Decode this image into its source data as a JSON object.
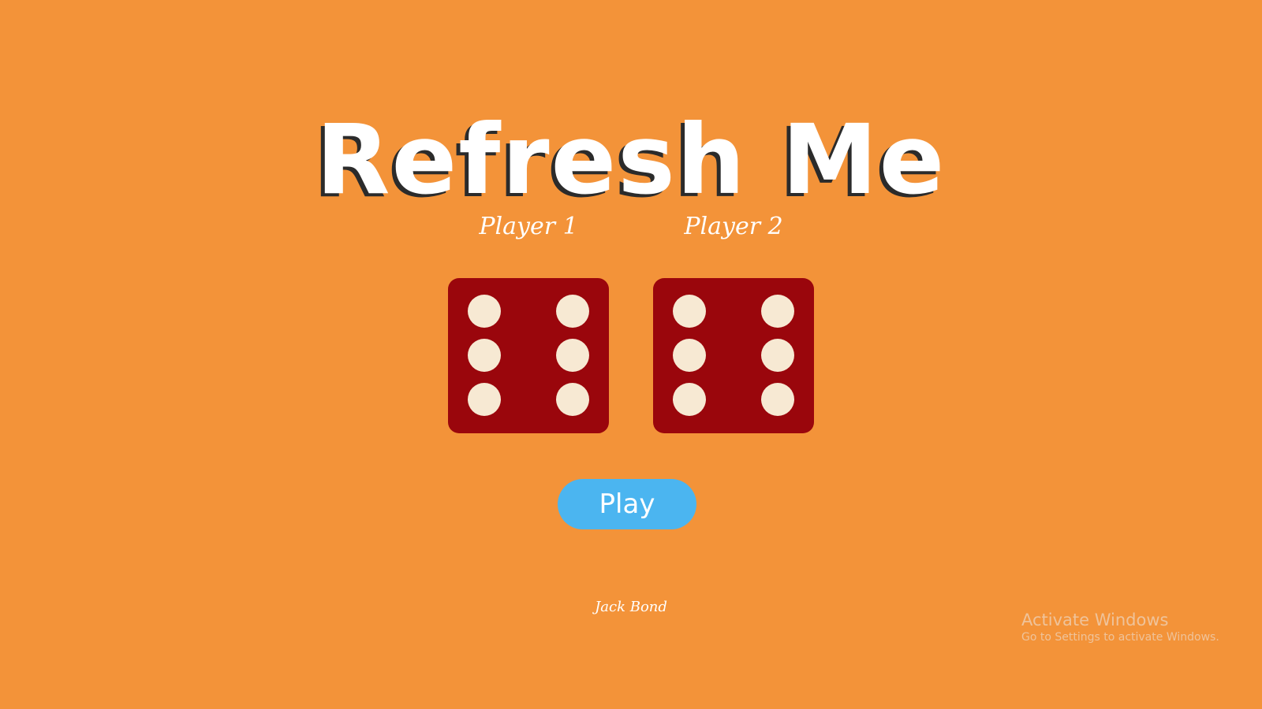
{
  "header": {
    "title": "Refresh Me"
  },
  "players": [
    {
      "label": "Player 1",
      "die_value": 6
    },
    {
      "label": "Player 2",
      "die_value": 6
    }
  ],
  "controls": {
    "play_label": "Play"
  },
  "footer": {
    "author": "Jack Bond"
  },
  "watermark": {
    "title": "Activate Windows",
    "subtitle": "Go to Settings to activate Windows."
  },
  "colors": {
    "background": "#F39339",
    "die": "#9A060C",
    "pip": "#F7E9D3",
    "button": "#4BB5F0",
    "title_shadow": "#2b2b2b"
  }
}
